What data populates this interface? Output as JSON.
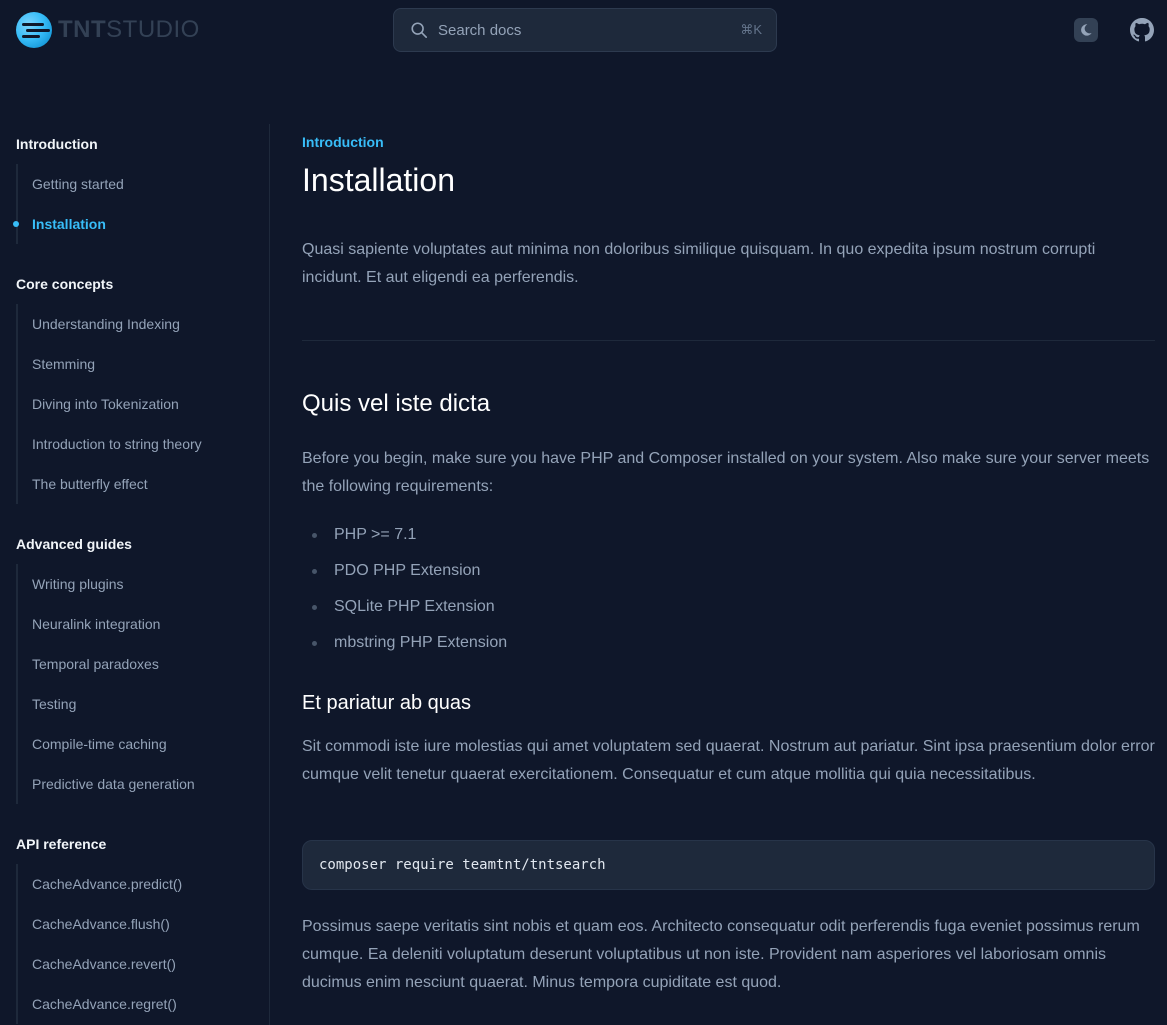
{
  "header": {
    "logo_bold": "TNT",
    "logo_regular": "STUDIO",
    "search_placeholder": "Search docs",
    "search_shortcut": "⌘K"
  },
  "sidebar": {
    "sections": [
      {
        "title": "Introduction",
        "items": [
          {
            "label": "Getting started",
            "active": false
          },
          {
            "label": "Installation",
            "active": true
          }
        ]
      },
      {
        "title": "Core concepts",
        "items": [
          {
            "label": "Understanding Indexing"
          },
          {
            "label": "Stemming"
          },
          {
            "label": "Diving into Tokenization"
          },
          {
            "label": "Introduction to string theory"
          },
          {
            "label": "The butterfly effect"
          }
        ]
      },
      {
        "title": "Advanced guides",
        "items": [
          {
            "label": "Writing plugins"
          },
          {
            "label": "Neuralink integration"
          },
          {
            "label": "Temporal paradoxes"
          },
          {
            "label": "Testing"
          },
          {
            "label": "Compile-time caching"
          },
          {
            "label": "Predictive data generation"
          }
        ]
      },
      {
        "title": "API reference",
        "items": [
          {
            "label": "CacheAdvance.predict()"
          },
          {
            "label": "CacheAdvance.flush()"
          },
          {
            "label": "CacheAdvance.revert()"
          },
          {
            "label": "CacheAdvance.regret()"
          }
        ]
      }
    ]
  },
  "main": {
    "eyebrow": "Introduction",
    "title": "Installation",
    "lead": "Quasi sapiente voluptates aut minima non doloribus similique quisquam. In quo expedita ipsum nostrum corrupti incidunt. Et aut eligendi ea perferendis.",
    "section_heading": "Quis vel iste dicta",
    "intro_paragraph": "Before you begin, make sure you have PHP and Composer installed on your system. Also make sure your server meets the following requirements:",
    "requirements": [
      "PHP >= 7.1",
      "PDO PHP Extension",
      "SQLite PHP Extension",
      "mbstring PHP Extension"
    ],
    "subheading": "Et pariatur ab quas",
    "sub_paragraph": "Sit commodi iste iure molestias qui amet voluptatem sed quaerat. Nostrum aut pariatur. Sint ipsa praesentium dolor error cumque velit tenetur quaerat exercitationem. Consequatur et cum atque mollitia qui quia necessitatibus.",
    "code": "composer require teamtnt/tntsearch",
    "closing_paragraph": "Possimus saepe veritatis sint nobis et quam eos. Architecto consequatur odit perferendis fuga eveniet possimus rerum cumque. Ea deleniti voluptatum deserunt voluptatibus ut non iste. Provident nam asperiores vel laboriosam omnis ducimus enim nesciunt quaerat. Minus tempora cupiditate est quod."
  },
  "colors": {
    "background": "#0f172a",
    "accent": "#38bdf8",
    "panel": "#1e293b"
  },
  "icons": [
    "search-icon",
    "theme-toggle-icon",
    "github-icon"
  ]
}
